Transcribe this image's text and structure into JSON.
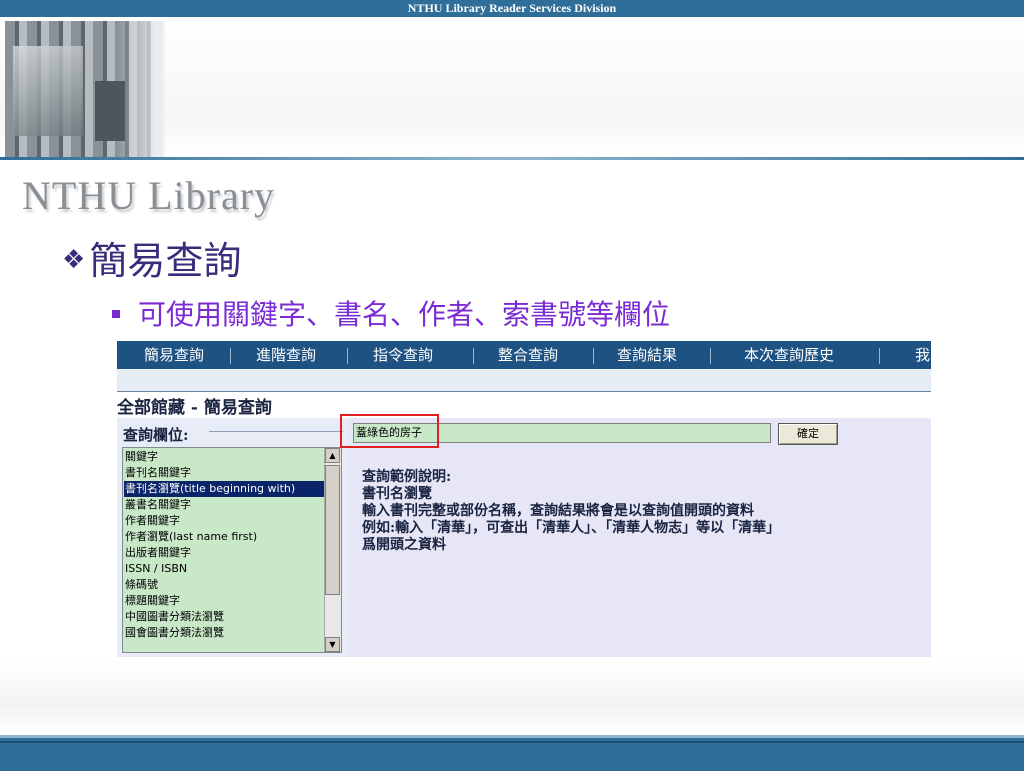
{
  "header": {
    "division": "NTHU Library Reader Services Division",
    "library_name": "NTHU Library"
  },
  "slide": {
    "heading": "簡易查詢",
    "subpoint": "可使用關鍵字、書名、作者、索書號等欄位"
  },
  "screenshot": {
    "nav": {
      "items": [
        {
          "label": "簡易查詢"
        },
        {
          "label": "進階查詢"
        },
        {
          "label": "指令查詢"
        },
        {
          "label": "整合查詢"
        },
        {
          "label": "查詢結果"
        },
        {
          "label": "本次查詢歷史"
        },
        {
          "label": "我"
        }
      ]
    },
    "page_title": "全部館藏 - 簡易查詢",
    "field_label": "查詢欄位:",
    "fields": {
      "options": [
        "關鍵字",
        "書刊名關鍵字",
        "書刊名瀏覽(title beginning with)",
        "叢書名關鍵字",
        "作者關鍵字",
        "作者瀏覽(last name first)",
        "出版者關鍵字",
        "ISSN / ISBN",
        "條碼號",
        "標題關鍵字",
        "中國圖書分類法瀏覽",
        "國會圖書分類法瀏覽"
      ],
      "selected": "書刊名瀏覽(title beginning with)"
    },
    "query_value": "蓋綠色的房子",
    "submit_label": "確定",
    "help": {
      "title": "查詢範例說明:",
      "field_name": "書刊名瀏覽",
      "line1": "輸入書刊完整或部份名稱，查詢結果將會是以查詢值開頭的資料",
      "line2": "例如:輸入「清華」，可查出「清華人」、「清華人物志」等以「清華」",
      "line3": "爲開頭之資料"
    }
  },
  "colors": {
    "top_bar": "#2f6e98",
    "heading": "#3a2c7a",
    "subpoint": "#7b2bd3",
    "nav_background": "#1e5283",
    "list_background": "#c8e8c8",
    "selected_item": "#0a246a",
    "highlight_box": "#e02020"
  }
}
